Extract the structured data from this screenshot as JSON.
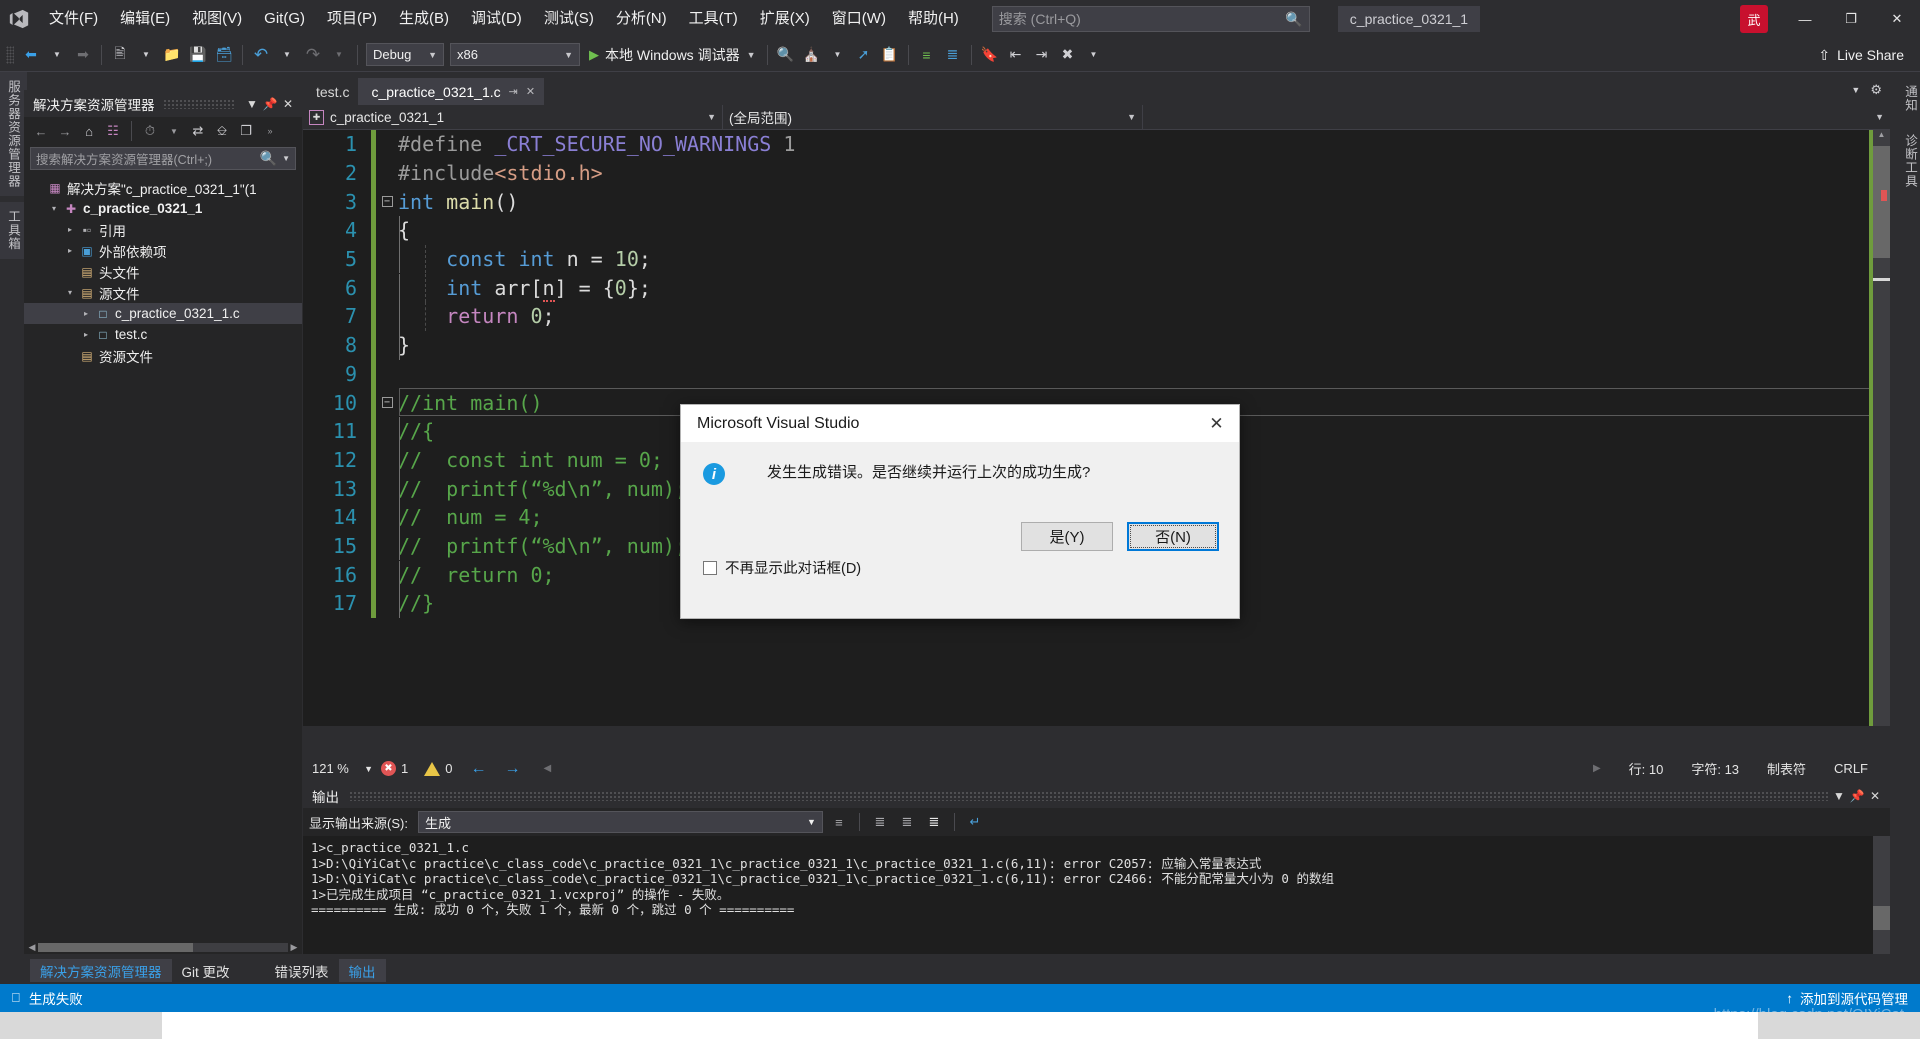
{
  "window": {
    "project_chip": "c_practice_0321_1",
    "avatar_initial": "武",
    "minimize": "—",
    "maximize": "❐",
    "close": "✕"
  },
  "menubar": {
    "items": [
      "文件(F)",
      "编辑(E)",
      "视图(V)",
      "Git(G)",
      "项目(P)",
      "生成(B)",
      "调试(D)",
      "测试(S)",
      "分析(N)",
      "工具(T)",
      "扩展(X)",
      "窗口(W)",
      "帮助(H)"
    ]
  },
  "search": {
    "placeholder": "搜索 (Ctrl+Q)",
    "icon": "search-icon"
  },
  "toolbar": {
    "nav_back": "◀",
    "nav_forward": "▶",
    "new_item": "❐",
    "open": "▢",
    "save": "▣",
    "save_all": "▤",
    "undo": "↶",
    "redo": "↷",
    "config_value": "Debug",
    "platform_value": "x86",
    "run_label": "本地 Windows 调试器",
    "live_share": "Live Share"
  },
  "left_vtabs": [
    "服务器资源管理器",
    "工具箱"
  ],
  "right_vtabs": [
    "通知",
    "诊断工具"
  ],
  "solution_explorer": {
    "title": "解决方案资源管理器",
    "search_placeholder": "搜索解决方案资源管理器(Ctrl+;)",
    "tree": [
      {
        "label": "解决方案\"c_practice_0321_1\"(1",
        "indent": 0,
        "twisty": "",
        "icon": "solution-icon",
        "icon_color": "#c586c0",
        "bold": false,
        "selected": false
      },
      {
        "label": "c_practice_0321_1",
        "indent": 1,
        "twisty": "▾",
        "icon": "project-icon",
        "icon_color": "#c586c0",
        "bold": true,
        "selected": false
      },
      {
        "label": "引用",
        "indent": 2,
        "twisty": "▸",
        "icon": "references-icon",
        "icon_color": "#b0b0b4",
        "bold": false,
        "selected": false
      },
      {
        "label": "外部依赖项",
        "indent": 2,
        "twisty": "▸",
        "icon": "external-deps-icon",
        "icon_color": "#4a9fd8",
        "bold": false,
        "selected": false
      },
      {
        "label": "头文件",
        "indent": 2,
        "twisty": "",
        "icon": "folder-filter-icon",
        "icon_color": "#dcb67a",
        "bold": false,
        "selected": false
      },
      {
        "label": "源文件",
        "indent": 2,
        "twisty": "▾",
        "icon": "folder-filter-icon",
        "icon_color": "#dcb67a",
        "bold": false,
        "selected": false
      },
      {
        "label": "c_practice_0321_1.c",
        "indent": 3,
        "twisty": "▸",
        "icon": "c-file-icon",
        "icon_color": "#9fd3ea",
        "bold": false,
        "selected": true
      },
      {
        "label": "test.c",
        "indent": 3,
        "twisty": "▸",
        "icon": "c-file-icon",
        "icon_color": "#9fd3ea",
        "bold": false,
        "selected": false
      },
      {
        "label": "资源文件",
        "indent": 2,
        "twisty": "",
        "icon": "folder-filter-icon",
        "icon_color": "#dcb67a",
        "bold": false,
        "selected": false
      }
    ]
  },
  "editor": {
    "tabs": [
      {
        "label": "test.c",
        "active": false
      },
      {
        "label": "c_practice_0321_1.c",
        "active": true
      }
    ],
    "nav_project": "c_practice_0321_1",
    "nav_scope": "(全局范围)",
    "lines": [
      {
        "n": 1,
        "fold": "",
        "tokens": [
          {
            "t": "#define ",
            "c": "macro"
          },
          {
            "t": "_CRT_SECURE_NO_WARNINGS",
            "c": "mname"
          },
          {
            "t": " 1",
            "c": "macro"
          }
        ]
      },
      {
        "n": 2,
        "fold": "",
        "tokens": [
          {
            "t": "#include",
            "c": "macro"
          },
          {
            "t": "<stdio.h>",
            "c": "str"
          }
        ]
      },
      {
        "n": 3,
        "fold": "-",
        "tokens": [
          {
            "t": "int",
            "c": "kw"
          },
          {
            "t": " ",
            "c": "plain"
          },
          {
            "t": "main",
            "c": "fn"
          },
          {
            "t": "()",
            "c": "plain"
          }
        ]
      },
      {
        "n": 4,
        "fold": "",
        "tokens": [
          {
            "t": "{",
            "c": "plain"
          }
        ]
      },
      {
        "n": 5,
        "fold": "",
        "tokens": [
          {
            "t": "    ",
            "c": "plain"
          },
          {
            "t": "const",
            "c": "kw"
          },
          {
            "t": " ",
            "c": "plain"
          },
          {
            "t": "int",
            "c": "kw"
          },
          {
            "t": " n = ",
            "c": "plain"
          },
          {
            "t": "10",
            "c": "num"
          },
          {
            "t": ";",
            "c": "plain"
          }
        ]
      },
      {
        "n": 6,
        "fold": "",
        "tokens": [
          {
            "t": "    ",
            "c": "plain"
          },
          {
            "t": "int",
            "c": "kw"
          },
          {
            "t": " arr[",
            "c": "plain"
          },
          {
            "t": "n",
            "c": "squig"
          },
          {
            "t": "] = {",
            "c": "plain"
          },
          {
            "t": "0",
            "c": "num"
          },
          {
            "t": "};",
            "c": "plain"
          }
        ]
      },
      {
        "n": 7,
        "fold": "",
        "tokens": [
          {
            "t": "    ",
            "c": "plain"
          },
          {
            "t": "return",
            "c": "kw2"
          },
          {
            "t": " ",
            "c": "plain"
          },
          {
            "t": "0",
            "c": "num"
          },
          {
            "t": ";",
            "c": "plain"
          }
        ]
      },
      {
        "n": 8,
        "fold": "",
        "tokens": [
          {
            "t": "}",
            "c": "plain"
          }
        ]
      },
      {
        "n": 9,
        "fold": "",
        "tokens": []
      },
      {
        "n": 10,
        "fold": "-",
        "tokens": [
          {
            "t": "//int main()",
            "c": "cmt"
          }
        ]
      },
      {
        "n": 11,
        "fold": "",
        "tokens": [
          {
            "t": "//{",
            "c": "cmt"
          }
        ]
      },
      {
        "n": 12,
        "fold": "",
        "tokens": [
          {
            "t": "//  const int num = 0;",
            "c": "cmt"
          }
        ]
      },
      {
        "n": 13,
        "fold": "",
        "tokens": [
          {
            "t": "//  printf(“%d\\n”, num);",
            "c": "cmt"
          }
        ]
      },
      {
        "n": 14,
        "fold": "",
        "tokens": [
          {
            "t": "//  num = 4;",
            "c": "cmt"
          }
        ]
      },
      {
        "n": 15,
        "fold": "",
        "tokens": [
          {
            "t": "//  printf(“%d\\n”, num);",
            "c": "cmt"
          }
        ]
      },
      {
        "n": 16,
        "fold": "",
        "tokens": [
          {
            "t": "//  return 0;",
            "c": "cmt"
          }
        ]
      },
      {
        "n": 17,
        "fold": "",
        "tokens": [
          {
            "t": "//}",
            "c": "cmt"
          }
        ]
      }
    ],
    "current_line": 10,
    "status": {
      "zoom": "121 %",
      "error_count": "1",
      "warning_count": "0",
      "line_label": "行: 10",
      "char_label": "字符: 13",
      "tabs_label": "制表符",
      "eol_label": "CRLF"
    }
  },
  "output": {
    "title": "输出",
    "source_label": "显示输出来源(S):",
    "source_value": "生成",
    "lines": [
      "1>c_practice_0321_1.c",
      "1>D:\\QiYiCat\\c practice\\c_class_code\\c_practice_0321_1\\c_practice_0321_1\\c_practice_0321_1.c(6,11): error C2057: 应输入常量表达式",
      "1>D:\\QiYiCat\\c practice\\c_class_code\\c_practice_0321_1\\c_practice_0321_1\\c_practice_0321_1.c(6,11): error C2466: 不能分配常量大小为 0 的数组",
      "1>已完成生成项目 “c_practice_0321_1.vcxproj” 的操作 - 失败。",
      "========== 生成: 成功 0 个，失败 1 个，最新 0 个，跳过 0 个 =========="
    ]
  },
  "bottom_tabs": {
    "left": [
      {
        "label": "解决方案资源管理器",
        "active": true
      },
      {
        "label": "Git 更改",
        "active": false
      }
    ],
    "right": [
      {
        "label": "错误列表",
        "active": false
      },
      {
        "label": "输出",
        "active": true
      }
    ]
  },
  "statusbar": {
    "message": "生成失败",
    "source_control": "添加到源代码管理",
    "watermark": "https://blog.csdn.net/QIYiCat"
  },
  "dialog": {
    "title": "Microsoft Visual Studio",
    "message": "发生生成错误。是否继续并运行上次的成功生成?",
    "yes_label": "是(Y)",
    "no_label": "否(N)",
    "checkbox_label": "不再显示此对话框(D)",
    "close_icon": "✕",
    "info_icon": "i"
  },
  "colors": {
    "accent": "#007acc",
    "chrome": "#2d2d30",
    "editor_bg": "#1e1e1e",
    "error": "#e05555",
    "comment_green": "#57a64a"
  }
}
